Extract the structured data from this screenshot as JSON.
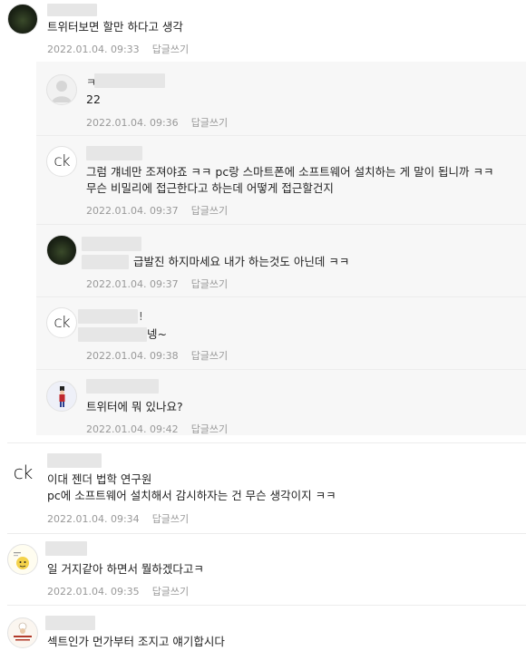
{
  "comments": [
    {
      "text": "트위터보면 할만 하다고 생각",
      "date": "2022.01.04. 09:33",
      "reply": "답글쓰기"
    },
    {
      "reply_to": 0,
      "author_prefix": "ㅋ",
      "text": "22",
      "date": "2022.01.04. 09:36",
      "reply": "답글쓰기"
    },
    {
      "reply_to": 0,
      "avatar_text": "ck",
      "text_line1": "그럼 걔네만 조져야죠 ㅋㅋ pc랑 스마트폰에 소프트웨어 설치하는 게 말이 됩니까 ㅋㅋ",
      "text_line2": "무슨 비밀리에 접근한다고 하는데 어떻게 접근할건지",
      "date": "2022.01.04. 09:37",
      "reply": "답글쓰기"
    },
    {
      "reply_to": 0,
      "text": "급발진 하지마세요 내가 하는것도 아닌데 ㅋㅋ",
      "date": "2022.01.04. 09:37",
      "reply": "답글쓰기"
    },
    {
      "reply_to": 0,
      "avatar_text": "ck",
      "author_suffix": "!",
      "text": "넹~",
      "date": "2022.01.04. 09:38",
      "reply": "답글쓰기"
    },
    {
      "reply_to": 0,
      "text": "트위터에 뭐 있나요?",
      "date": "2022.01.04. 09:42",
      "reply": "답글쓰기"
    },
    {
      "avatar_text": "ck",
      "text_line1": "이대 젠더 법학 연구원",
      "text_line2": "pc에 소프트웨어 설치해서 감시하자는 건 무슨 생각이지 ㅋㅋ",
      "date": "2022.01.04. 09:34",
      "reply": "답글쓰기"
    },
    {
      "text": "일 거지같아 하면서 뭘하겠다고ㅋ",
      "date": "2022.01.04. 09:35",
      "reply": "답글쓰기"
    },
    {
      "text": "섹트인가 먼가부터 조지고 얘기합시다"
    }
  ],
  "colors": {
    "meta": "#999999",
    "reply_bg": "#f7f7f7",
    "divider": "#ececec"
  }
}
